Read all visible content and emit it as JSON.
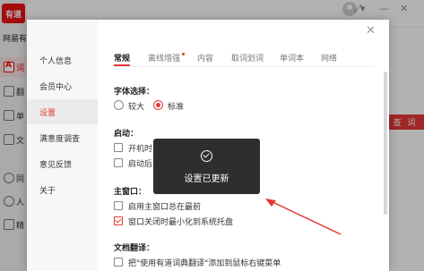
{
  "app": {
    "logo_text": "有道",
    "name": "网易有",
    "nav": [
      {
        "label": "词",
        "active": true
      },
      {
        "label": "翻"
      },
      {
        "label": "单"
      },
      {
        "label": "文"
      },
      {
        "label": "同"
      },
      {
        "label": "人"
      },
      {
        "label": "精"
      }
    ],
    "search_button": "查 词"
  },
  "dialog": {
    "side_items": [
      "个人信息",
      "会员中心",
      "设置",
      "满意度调查",
      "意见反馈",
      "关于"
    ],
    "active_side_index": 2,
    "tabs": [
      "常规",
      "离线增强",
      "内容",
      "取词划词",
      "单词本",
      "网络"
    ],
    "active_tab_index": 0,
    "font_section": {
      "title": "字体选择：",
      "options": [
        "较大",
        "标准"
      ],
      "selected": "标准"
    },
    "startup_section": {
      "title": "启动：",
      "options": [
        {
          "label": "开机时自",
          "checked": false
        },
        {
          "label": "启动后最",
          "checked": false
        }
      ]
    },
    "main_window_section": {
      "title": "主窗口：",
      "options": [
        {
          "label": "启用主窗口总在最前",
          "checked": false
        },
        {
          "label": "窗口关闭时最小化到系统托盘",
          "checked": true
        }
      ]
    },
    "doc_translate_section": {
      "title": "文档翻译：",
      "options": [
        {
          "label": "把\"使用有道词典翻译\"添加到鼠标右键菜单",
          "checked": false
        }
      ]
    }
  },
  "toast": {
    "icon": "check-circle-icon",
    "text": "设置已更新"
  },
  "colors": {
    "accent": "#e53935",
    "toast_bg": "#2e2e2e",
    "overlay": "rgba(0,0,0,0.30)"
  }
}
